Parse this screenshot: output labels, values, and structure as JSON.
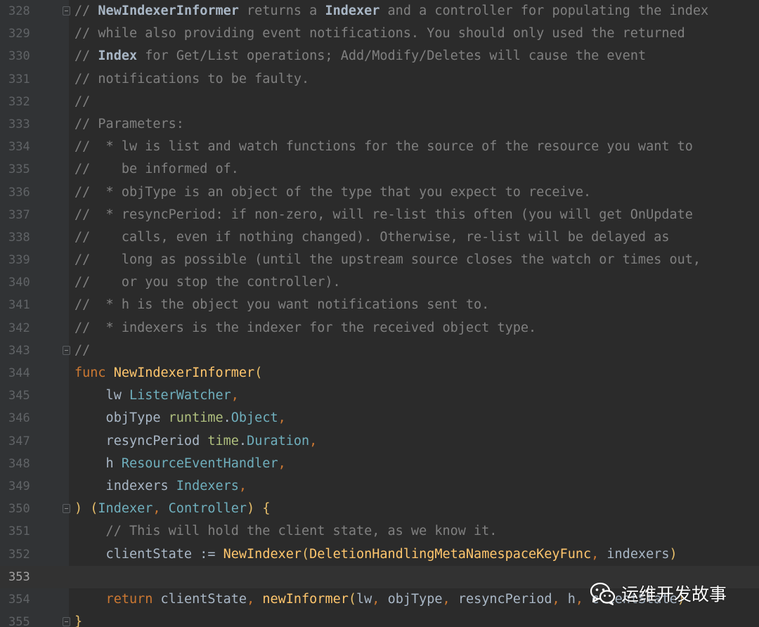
{
  "editor": {
    "colors": {
      "background": "#2b2b2b",
      "gutter": "#313335",
      "line_number": "#606366",
      "comment": "#808080",
      "keyword": "#cc7832",
      "function": "#ffc66d",
      "type": "#6fafbd",
      "package": "#afbf7e",
      "identifier": "#a9b7c6"
    },
    "current_line": "353",
    "lines": [
      {
        "number": "328",
        "fold": true,
        "tokens": [
          {
            "text": "// ",
            "style": "comment"
          },
          {
            "text": "NewIndexerInformer",
            "style": "comment-bold"
          },
          {
            "text": " returns a ",
            "style": "comment"
          },
          {
            "text": "Indexer",
            "style": "comment-bold"
          },
          {
            "text": " and a controller for populating the index",
            "style": "comment"
          }
        ]
      },
      {
        "number": "329",
        "fold": false,
        "tokens": [
          {
            "text": "// while also providing event notifications. You should only used the returned",
            "style": "comment"
          }
        ]
      },
      {
        "number": "330",
        "fold": false,
        "tokens": [
          {
            "text": "// ",
            "style": "comment"
          },
          {
            "text": "Index",
            "style": "comment-bold"
          },
          {
            "text": " for Get/List operations; Add/Modify/Deletes will cause the event",
            "style": "comment"
          }
        ]
      },
      {
        "number": "331",
        "fold": false,
        "tokens": [
          {
            "text": "// notifications to be faulty.",
            "style": "comment"
          }
        ]
      },
      {
        "number": "332",
        "fold": false,
        "tokens": [
          {
            "text": "//",
            "style": "comment"
          }
        ]
      },
      {
        "number": "333",
        "fold": false,
        "tokens": [
          {
            "text": "// Parameters:",
            "style": "comment"
          }
        ]
      },
      {
        "number": "334",
        "fold": false,
        "tokens": [
          {
            "text": "//  * lw is list and watch functions for the source of the resource you want to",
            "style": "comment"
          }
        ]
      },
      {
        "number": "335",
        "fold": false,
        "tokens": [
          {
            "text": "//    be informed of.",
            "style": "comment"
          }
        ]
      },
      {
        "number": "336",
        "fold": false,
        "tokens": [
          {
            "text": "//  * objType is an object of the type that you expect to receive.",
            "style": "comment"
          }
        ]
      },
      {
        "number": "337",
        "fold": false,
        "tokens": [
          {
            "text": "//  * resyncPeriod: if non-zero, will re-list this often (you will get OnUpdate",
            "style": "comment"
          }
        ]
      },
      {
        "number": "338",
        "fold": false,
        "tokens": [
          {
            "text": "//    calls, even if nothing changed). Otherwise, re-list will be delayed as",
            "style": "comment"
          }
        ]
      },
      {
        "number": "339",
        "fold": false,
        "tokens": [
          {
            "text": "//    long as possible (until the upstream source closes the watch or times out,",
            "style": "comment"
          }
        ]
      },
      {
        "number": "340",
        "fold": false,
        "tokens": [
          {
            "text": "//    or you stop the controller).",
            "style": "comment"
          }
        ]
      },
      {
        "number": "341",
        "fold": false,
        "tokens": [
          {
            "text": "//  * h is the object you want notifications sent to.",
            "style": "comment"
          }
        ]
      },
      {
        "number": "342",
        "fold": false,
        "tokens": [
          {
            "text": "//  * indexers is the indexer for the received object type.",
            "style": "comment"
          }
        ]
      },
      {
        "number": "343",
        "fold": true,
        "tokens": [
          {
            "text": "//",
            "style": "comment"
          }
        ]
      },
      {
        "number": "344",
        "fold": false,
        "tokens": [
          {
            "text": "func ",
            "style": "keyword"
          },
          {
            "text": "NewIndexerInformer",
            "style": "func-name"
          },
          {
            "text": "(",
            "style": "paren"
          }
        ]
      },
      {
        "number": "345",
        "fold": false,
        "tokens": [
          {
            "text": "    lw ",
            "style": "param"
          },
          {
            "text": "ListerWatcher",
            "style": "type"
          },
          {
            "text": ",",
            "style": "punct"
          }
        ]
      },
      {
        "number": "346",
        "fold": false,
        "tokens": [
          {
            "text": "    objType ",
            "style": "param"
          },
          {
            "text": "runtime",
            "style": "pkg"
          },
          {
            "text": ".",
            "style": "plain"
          },
          {
            "text": "Object",
            "style": "type"
          },
          {
            "text": ",",
            "style": "punct"
          }
        ]
      },
      {
        "number": "347",
        "fold": false,
        "tokens": [
          {
            "text": "    resyncPeriod ",
            "style": "param"
          },
          {
            "text": "time",
            "style": "pkg"
          },
          {
            "text": ".",
            "style": "plain"
          },
          {
            "text": "Duration",
            "style": "type"
          },
          {
            "text": ",",
            "style": "punct"
          }
        ]
      },
      {
        "number": "348",
        "fold": false,
        "tokens": [
          {
            "text": "    h ",
            "style": "param"
          },
          {
            "text": "ResourceEventHandler",
            "style": "type"
          },
          {
            "text": ",",
            "style": "punct"
          }
        ]
      },
      {
        "number": "349",
        "fold": false,
        "tokens": [
          {
            "text": "    indexers ",
            "style": "param"
          },
          {
            "text": "Indexers",
            "style": "type"
          },
          {
            "text": ",",
            "style": "punct"
          }
        ]
      },
      {
        "number": "350",
        "fold": true,
        "tokens": [
          {
            "text": ")",
            "style": "paren"
          },
          {
            "text": " (",
            "style": "paren"
          },
          {
            "text": "Indexer",
            "style": "type"
          },
          {
            "text": ", ",
            "style": "punct"
          },
          {
            "text": "Controller",
            "style": "type"
          },
          {
            "text": ") {",
            "style": "paren"
          }
        ]
      },
      {
        "number": "351",
        "fold": false,
        "tokens": [
          {
            "text": "    // This will hold the client state, as we know it.",
            "style": "comment"
          }
        ]
      },
      {
        "number": "352",
        "fold": false,
        "tokens": [
          {
            "text": "    clientState := ",
            "style": "plain"
          },
          {
            "text": "NewIndexer",
            "style": "call"
          },
          {
            "text": "(",
            "style": "paren"
          },
          {
            "text": "DeletionHandlingMetaNamespaceKeyFunc",
            "style": "call"
          },
          {
            "text": ", ",
            "style": "punct"
          },
          {
            "text": "indexers",
            "style": "plain"
          },
          {
            "text": ")",
            "style": "paren"
          }
        ]
      },
      {
        "number": "353",
        "fold": false,
        "tokens": []
      },
      {
        "number": "354",
        "fold": false,
        "tokens": [
          {
            "text": "    return ",
            "style": "keyword"
          },
          {
            "text": "clientState",
            "style": "plain"
          },
          {
            "text": ", ",
            "style": "punct"
          },
          {
            "text": "newInformer",
            "style": "call"
          },
          {
            "text": "(",
            "style": "paren"
          },
          {
            "text": "lw",
            "style": "plain"
          },
          {
            "text": ", ",
            "style": "punct"
          },
          {
            "text": "objType",
            "style": "plain"
          },
          {
            "text": ", ",
            "style": "punct"
          },
          {
            "text": "resyncPeriod",
            "style": "plain"
          },
          {
            "text": ", ",
            "style": "punct"
          },
          {
            "text": "h",
            "style": "plain"
          },
          {
            "text": ", ",
            "style": "punct"
          },
          {
            "text": "clientState",
            "style": "plain"
          },
          {
            "text": ")",
            "style": "paren"
          }
        ]
      },
      {
        "number": "355",
        "fold": true,
        "tokens": [
          {
            "text": "}",
            "style": "paren"
          }
        ]
      }
    ]
  },
  "watermark": {
    "icon": "wechat-icon",
    "text": "运维开发故事"
  }
}
